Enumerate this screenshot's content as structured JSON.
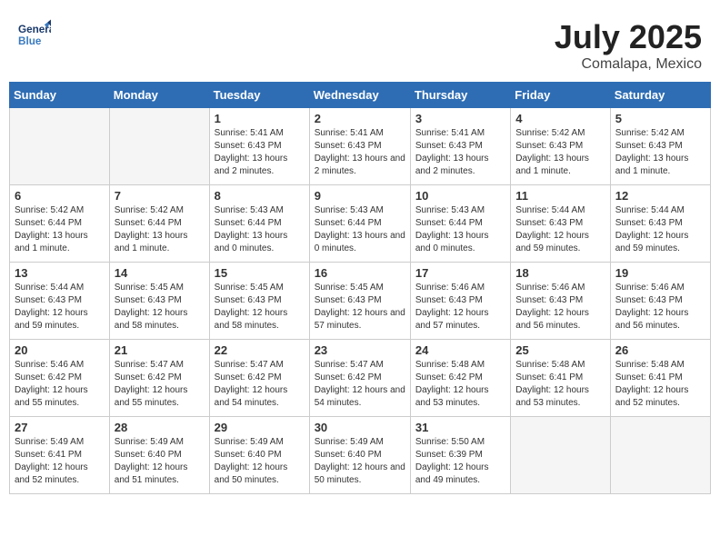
{
  "header": {
    "logo_general": "General",
    "logo_blue": "Blue",
    "month": "July 2025",
    "location": "Comalapa, Mexico"
  },
  "days_of_week": [
    "Sunday",
    "Monday",
    "Tuesday",
    "Wednesday",
    "Thursday",
    "Friday",
    "Saturday"
  ],
  "weeks": [
    [
      {
        "day": "",
        "info": ""
      },
      {
        "day": "",
        "info": ""
      },
      {
        "day": "1",
        "info": "Sunrise: 5:41 AM\nSunset: 6:43 PM\nDaylight: 13 hours and 2 minutes."
      },
      {
        "day": "2",
        "info": "Sunrise: 5:41 AM\nSunset: 6:43 PM\nDaylight: 13 hours and 2 minutes."
      },
      {
        "day": "3",
        "info": "Sunrise: 5:41 AM\nSunset: 6:43 PM\nDaylight: 13 hours and 2 minutes."
      },
      {
        "day": "4",
        "info": "Sunrise: 5:42 AM\nSunset: 6:43 PM\nDaylight: 13 hours and 1 minute."
      },
      {
        "day": "5",
        "info": "Sunrise: 5:42 AM\nSunset: 6:43 PM\nDaylight: 13 hours and 1 minute."
      }
    ],
    [
      {
        "day": "6",
        "info": "Sunrise: 5:42 AM\nSunset: 6:44 PM\nDaylight: 13 hours and 1 minute."
      },
      {
        "day": "7",
        "info": "Sunrise: 5:42 AM\nSunset: 6:44 PM\nDaylight: 13 hours and 1 minute."
      },
      {
        "day": "8",
        "info": "Sunrise: 5:43 AM\nSunset: 6:44 PM\nDaylight: 13 hours and 0 minutes."
      },
      {
        "day": "9",
        "info": "Sunrise: 5:43 AM\nSunset: 6:44 PM\nDaylight: 13 hours and 0 minutes."
      },
      {
        "day": "10",
        "info": "Sunrise: 5:43 AM\nSunset: 6:44 PM\nDaylight: 13 hours and 0 minutes."
      },
      {
        "day": "11",
        "info": "Sunrise: 5:44 AM\nSunset: 6:43 PM\nDaylight: 12 hours and 59 minutes."
      },
      {
        "day": "12",
        "info": "Sunrise: 5:44 AM\nSunset: 6:43 PM\nDaylight: 12 hours and 59 minutes."
      }
    ],
    [
      {
        "day": "13",
        "info": "Sunrise: 5:44 AM\nSunset: 6:43 PM\nDaylight: 12 hours and 59 minutes."
      },
      {
        "day": "14",
        "info": "Sunrise: 5:45 AM\nSunset: 6:43 PM\nDaylight: 12 hours and 58 minutes."
      },
      {
        "day": "15",
        "info": "Sunrise: 5:45 AM\nSunset: 6:43 PM\nDaylight: 12 hours and 58 minutes."
      },
      {
        "day": "16",
        "info": "Sunrise: 5:45 AM\nSunset: 6:43 PM\nDaylight: 12 hours and 57 minutes."
      },
      {
        "day": "17",
        "info": "Sunrise: 5:46 AM\nSunset: 6:43 PM\nDaylight: 12 hours and 57 minutes."
      },
      {
        "day": "18",
        "info": "Sunrise: 5:46 AM\nSunset: 6:43 PM\nDaylight: 12 hours and 56 minutes."
      },
      {
        "day": "19",
        "info": "Sunrise: 5:46 AM\nSunset: 6:43 PM\nDaylight: 12 hours and 56 minutes."
      }
    ],
    [
      {
        "day": "20",
        "info": "Sunrise: 5:46 AM\nSunset: 6:42 PM\nDaylight: 12 hours and 55 minutes."
      },
      {
        "day": "21",
        "info": "Sunrise: 5:47 AM\nSunset: 6:42 PM\nDaylight: 12 hours and 55 minutes."
      },
      {
        "day": "22",
        "info": "Sunrise: 5:47 AM\nSunset: 6:42 PM\nDaylight: 12 hours and 54 minutes."
      },
      {
        "day": "23",
        "info": "Sunrise: 5:47 AM\nSunset: 6:42 PM\nDaylight: 12 hours and 54 minutes."
      },
      {
        "day": "24",
        "info": "Sunrise: 5:48 AM\nSunset: 6:42 PM\nDaylight: 12 hours and 53 minutes."
      },
      {
        "day": "25",
        "info": "Sunrise: 5:48 AM\nSunset: 6:41 PM\nDaylight: 12 hours and 53 minutes."
      },
      {
        "day": "26",
        "info": "Sunrise: 5:48 AM\nSunset: 6:41 PM\nDaylight: 12 hours and 52 minutes."
      }
    ],
    [
      {
        "day": "27",
        "info": "Sunrise: 5:49 AM\nSunset: 6:41 PM\nDaylight: 12 hours and 52 minutes."
      },
      {
        "day": "28",
        "info": "Sunrise: 5:49 AM\nSunset: 6:40 PM\nDaylight: 12 hours and 51 minutes."
      },
      {
        "day": "29",
        "info": "Sunrise: 5:49 AM\nSunset: 6:40 PM\nDaylight: 12 hours and 50 minutes."
      },
      {
        "day": "30",
        "info": "Sunrise: 5:49 AM\nSunset: 6:40 PM\nDaylight: 12 hours and 50 minutes."
      },
      {
        "day": "31",
        "info": "Sunrise: 5:50 AM\nSunset: 6:39 PM\nDaylight: 12 hours and 49 minutes."
      },
      {
        "day": "",
        "info": ""
      },
      {
        "day": "",
        "info": ""
      }
    ]
  ]
}
